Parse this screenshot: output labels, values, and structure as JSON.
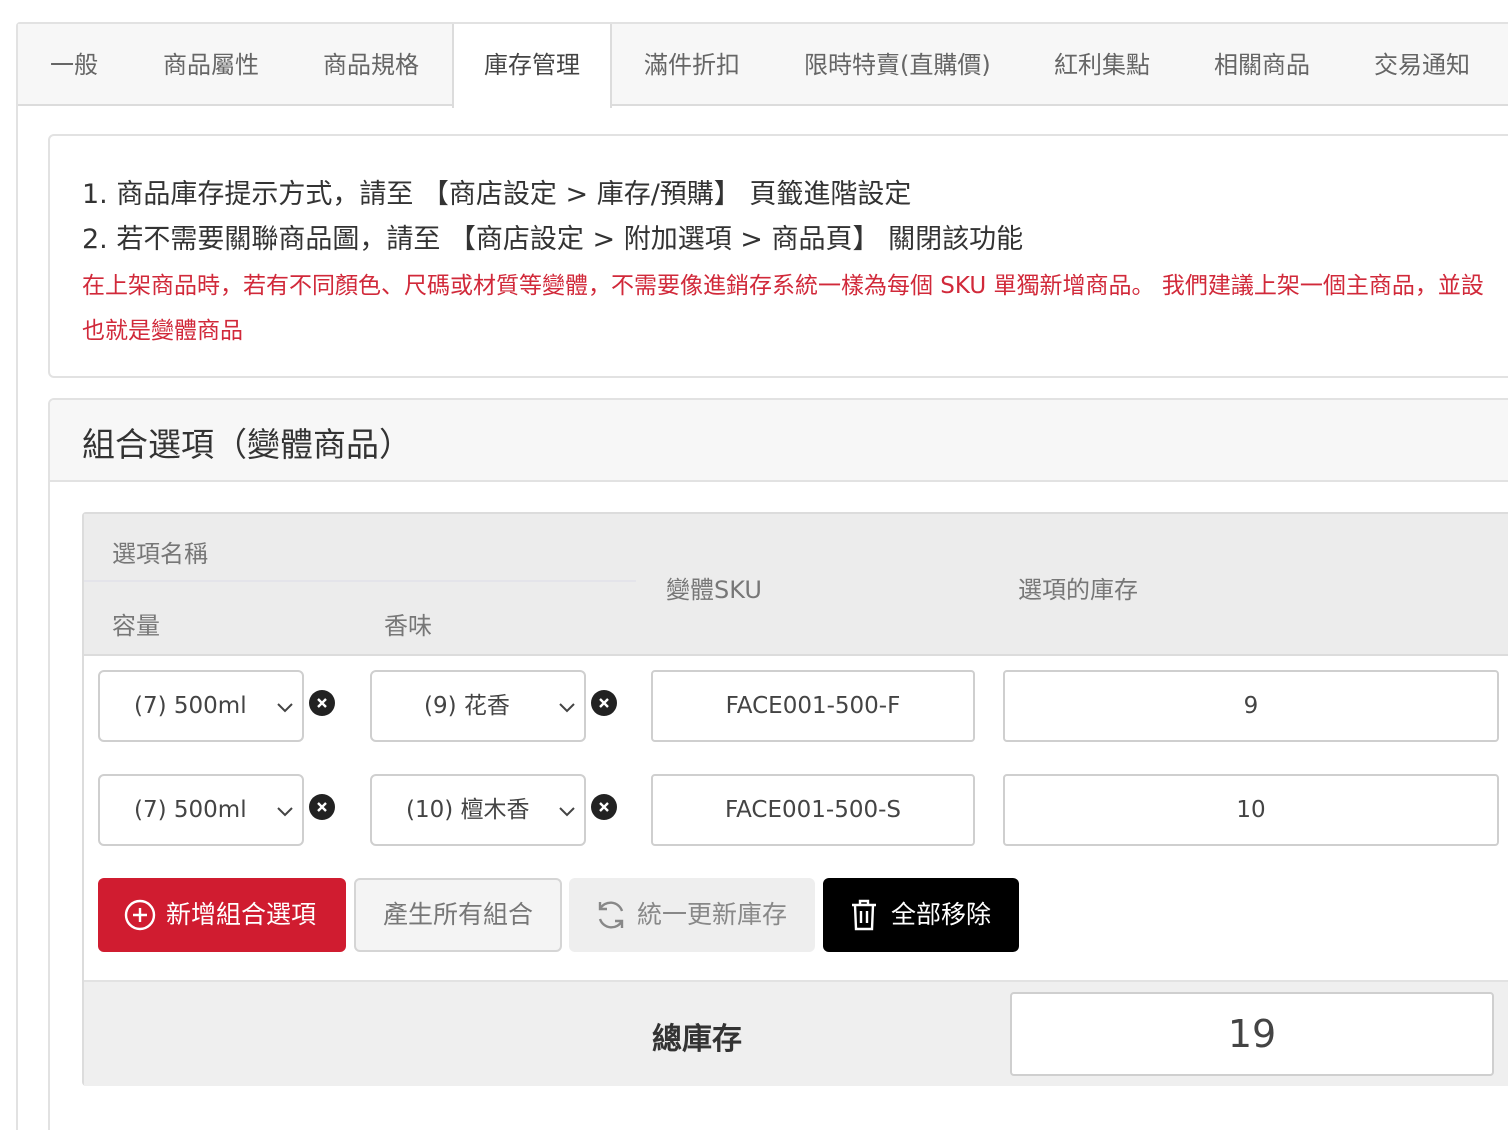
{
  "tabs": [
    {
      "label": "一般"
    },
    {
      "label": "商品屬性"
    },
    {
      "label": "商品規格"
    },
    {
      "label": "庫存管理",
      "active": true
    },
    {
      "label": "滿件折扣"
    },
    {
      "label": "限時特賣(直購價)"
    },
    {
      "label": "紅利集點"
    },
    {
      "label": "相關商品"
    },
    {
      "label": "交易通知"
    }
  ],
  "notice": {
    "line1": "1. 商品庫存提示方式，請至 【商店設定 > 庫存/預購】 頁籤進階設定",
    "line2": "2. 若不需要關聯商品圖，請至 【商店設定 > 附加選項 > 商品頁】 關閉該功能",
    "red1": "在上架商品時，若有不同顏色、尺碼或材質等變體，不需要像進銷存系統一樣為每個 SKU 單獨新增商品。 我們建議上架一個主商品，並設",
    "red2": "也就是變體商品"
  },
  "variants": {
    "title": "組合選項（變體商品）",
    "headers": {
      "option_name": "選項名稱",
      "capacity": "容量",
      "scent": "香味",
      "sku": "變體SKU",
      "stock": "選項的庫存"
    },
    "rows": [
      {
        "capacity": "(7) 500ml",
        "scent": "(9) 花香",
        "sku": "FACE001-500-F",
        "stock": "9"
      },
      {
        "capacity": "(7) 500ml",
        "scent": "(10) 檀木香",
        "sku": "FACE001-500-S",
        "stock": "10"
      }
    ],
    "buttons": {
      "add": "新增組合選項",
      "generate": "產生所有組合",
      "update_stock": "統一更新庫存",
      "remove_all": "全部移除"
    },
    "total_label": "總庫存",
    "total_value": "19"
  },
  "colors": {
    "accent_red": "#d01c30",
    "notice_red": "#d1293a",
    "black_button": "#000000"
  },
  "icons": [
    "chevron-down-icon",
    "clear-circle-icon",
    "plus-circle-icon",
    "refresh-icon",
    "trash-icon"
  ]
}
